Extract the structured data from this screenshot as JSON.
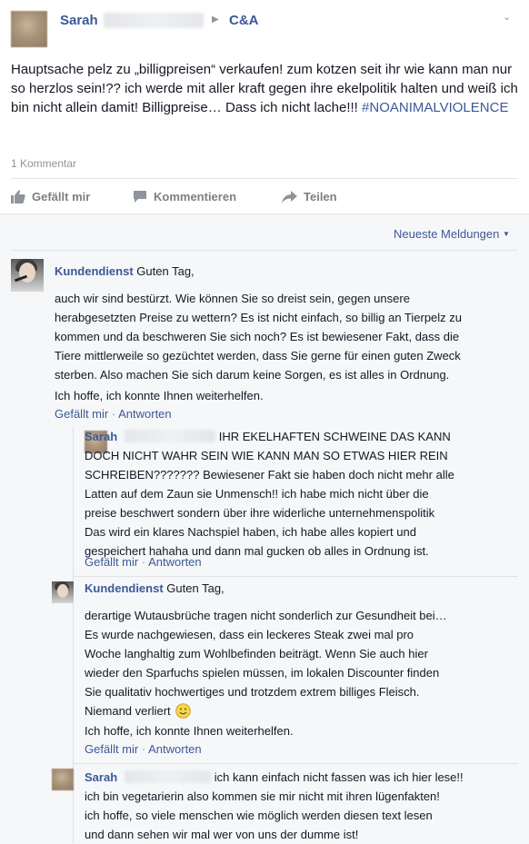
{
  "post": {
    "author": "Sarah",
    "target": "C&A",
    "text": "Hauptsache pelz zu „billigpreisen“ verkaufen! zum kotzen seit ihr wie kann man nur so herzlos sein!?? ich werde mit aller kraft gegen ihre ekelpolitik halten und weiß ich bin nicht allein damit! Billigpreise… Dass ich nicht lache!!! ",
    "hashtag": "#NOANIMALVIOLENCE",
    "comment_count": "1 Kommentar"
  },
  "actions": {
    "like": "Gefällt mir",
    "comment": "Kommentieren",
    "share": "Teilen"
  },
  "sort": {
    "label": "Neueste Meldungen"
  },
  "comments": [
    {
      "author": "Kundendienst",
      "first": "Guten Tag,",
      "lines": [
        "auch wir sind bestürzt. Wie können Sie so dreist sein, gegen unsere",
        "herabgesetzten Preise zu wettern? Es ist nicht einfach, so billig an Tierpelz zu",
        "kommen und da beschweren Sie sich noch? Es ist bewiesener Fakt, dass die",
        "Tiere mittlerweile so gezüchtet werden, dass Sie gerne für einen guten Zweck",
        "sterben. Also machen Sie sich darum keine Sorgen, es ist alles in Ordnung."
      ],
      "closing": "Ich hoffe, ich konnte Ihnen weiterhelfen.",
      "like": "Gefällt mir",
      "reply": "Antworten"
    }
  ],
  "replies": [
    {
      "author": "Sarah",
      "lines": [
        "IHR EKELHAFTEN SCHWEINE DAS KANN",
        "DOCH NICHT WAHR SEIN WIE KANN MAN SO ETWAS HIER REIN",
        "SCHREIBEN??????? Bewiesener Fakt sie haben doch nicht mehr alle",
        "Latten auf dem Zaun sie Unmensch!! ich habe mich nicht über die",
        "preise beschwert sondern über ihre widerliche unternehmenspolitik",
        "Das wird ein klares Nachspiel haben, ich habe alles kopiert und",
        "gespeichert hahaha und dann mal gucken ob alles in Ordnung ist."
      ],
      "like": "Gefällt mir",
      "reply": "Antworten"
    },
    {
      "author": "Kundendienst",
      "first": "Guten Tag,",
      "lines": [
        "derartige Wutausbrüche tragen nicht sonderlich zur Gesundheit bei…",
        "Es wurde nachgewiesen, dass ein leckeres Steak zwei mal pro",
        "Woche langhaltig zum Wohlbefinden beiträgt. Wenn Sie auch hier",
        "wieder den Sparfuchs spielen müssen, im lokalen Discounter finden",
        "Sie qualitativ hochwertiges und trotzdem extrem billiges Fleisch.",
        "Niemand verliert"
      ],
      "closing": "Ich hoffe, ich konnte Ihnen weiterhelfen.",
      "like": "Gefällt mir",
      "reply": "Antworten"
    },
    {
      "author": "Sarah",
      "lines": [
        "ich kann einfach nicht fassen was ich hier lese!!",
        "ich bin vegetarierin also kommen sie mir nicht mit ihren lügenfakten!",
        "ich hoffe, so viele menschen wie möglich werden diesen text lesen",
        "und dann sehen wir mal wer von uns der dumme ist!"
      ]
    }
  ],
  "icons": {
    "dropdown": "chevron-down-icon",
    "like": "thumbs-up-icon",
    "comment": "speech-bubble-icon",
    "share": "share-arrow-icon",
    "smiley": "smiley-icon"
  },
  "colors": {
    "link": "#3b5998",
    "muted": "#90949c",
    "comments_bg": "#f6f7f9"
  }
}
